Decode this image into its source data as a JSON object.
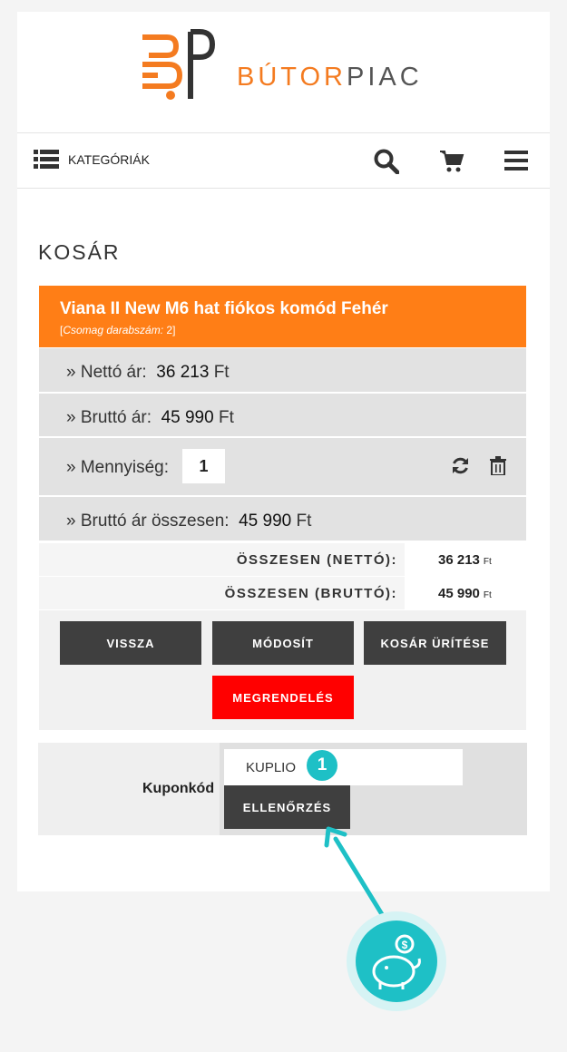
{
  "logo": {
    "text_a": "BÚTOR",
    "text_b": "PIAC"
  },
  "nav": {
    "categories_label": "KATEGÓRIÁK",
    "icons": [
      "list-icon",
      "search-icon",
      "cart-icon",
      "menu-icon"
    ]
  },
  "page": {
    "title": "KOSÁR"
  },
  "product": {
    "name": "Viana II New M6 hat fiókos komód Fehér",
    "package_label": "Csomag darabszám:",
    "package_count": "2"
  },
  "rows": {
    "net_label": "» Nettó ár:",
    "net_value": "36 213",
    "gross_label": "» Bruttó ár:",
    "gross_value": "45 990",
    "qty_label": "» Mennyiség:",
    "qty_value": "1",
    "gross_total_label": "» Bruttó ár összesen:",
    "gross_total_value": "45 990",
    "currency": "Ft"
  },
  "totals": {
    "net_label": "ÖSSZESEN (NETTÓ):",
    "net_value": "36 213",
    "gross_label": "ÖSSZESEN (BRUTTÓ):",
    "gross_value": "45 990",
    "currency": "Ft"
  },
  "buttons": {
    "back": "VISSZA",
    "modify": "MÓDOSÍT",
    "empty_cart": "KOSÁR ÜRÍTÉSE",
    "order": "MEGRENDELÉS"
  },
  "coupon": {
    "label": "Kuponkód",
    "value": "KUPLIO",
    "badge": "1",
    "check_button": "ELLENŐRZÉS"
  },
  "colors": {
    "accent_orange": "#ff7e16",
    "order_red": "#ff0000",
    "teal": "#1ec0c6",
    "dark_button": "#3f3f3f"
  }
}
